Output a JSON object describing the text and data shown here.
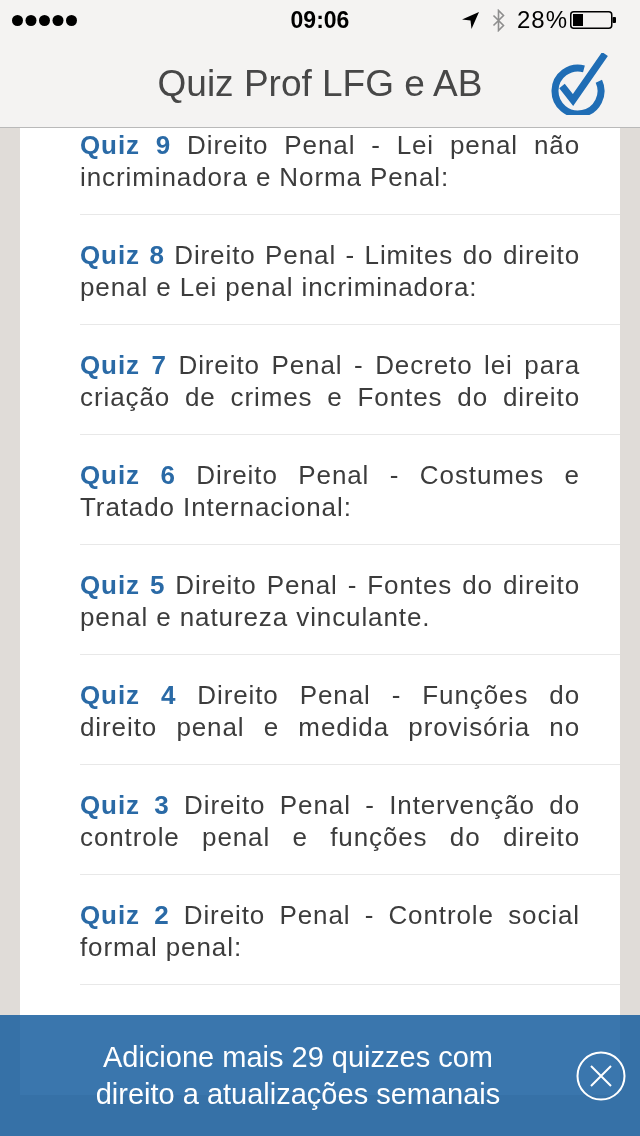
{
  "status_bar": {
    "time": "09:06",
    "battery_percent": "28%"
  },
  "nav_bar": {
    "title": "Quiz Prof LFG e AB"
  },
  "quizzes": [
    {
      "label": "Quiz 9",
      "title": "Direito Penal - Lei penal não incriminadora e Norma Penal:",
      "clipped": false
    },
    {
      "label": "Quiz 8",
      "title": "Direito Penal - Limites do direito penal e Lei penal incriminadora:",
      "clipped": false
    },
    {
      "label": "Quiz 7",
      "title": "Direito Penal - Decreto lei para criação de crimes e Fontes do direito",
      "clipped": true
    },
    {
      "label": "Quiz 6",
      "title": "Direito Penal - Costumes e Tratado Internacional:",
      "clipped": false
    },
    {
      "label": "Quiz 5",
      "title": "Direito Penal - Fontes do direito penal e natureza vinculante.",
      "clipped": false
    },
    {
      "label": "Quiz 4",
      "title": "Direito Penal - Funções do direito penal e medida provisória no",
      "clipped": true
    },
    {
      "label": "Quiz 3",
      "title": "Direito Penal - Intervenção do controle penal e funções do direito",
      "clipped": true
    },
    {
      "label": "Quiz 2",
      "title": "Direito Penal - Controle social formal penal:",
      "clipped": false
    }
  ],
  "banner": {
    "text": "Adicione mais 29 quizzes com direito a atualizações semanais"
  }
}
